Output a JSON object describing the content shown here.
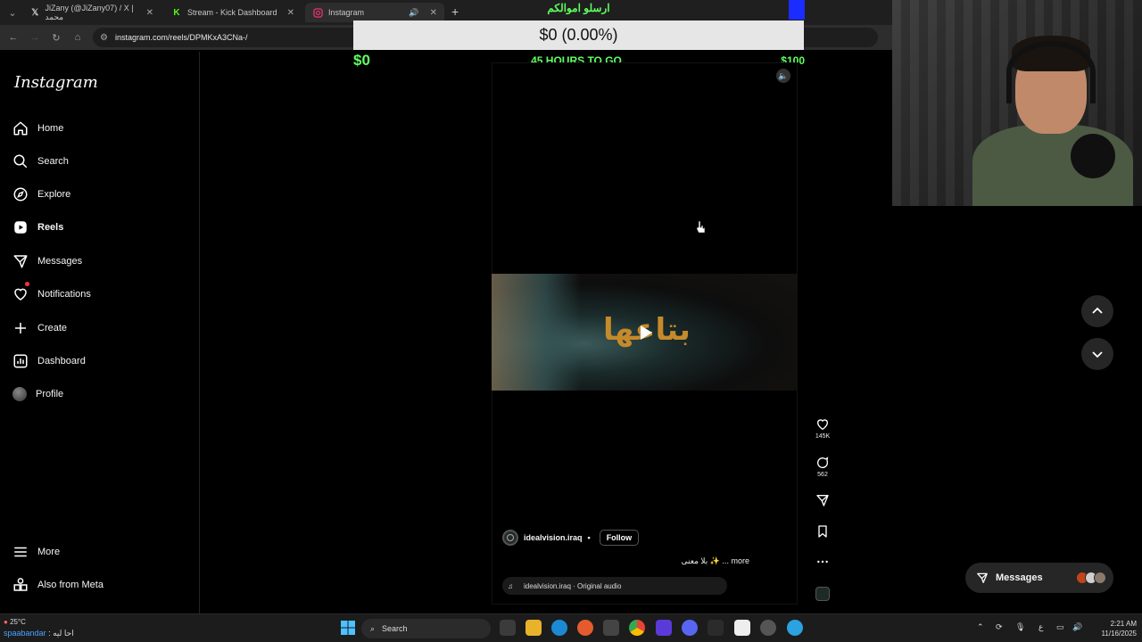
{
  "browser": {
    "tabs": [
      {
        "label": "JiZany (@JiZany07) / X | محمد",
        "icon": "x-icon"
      },
      {
        "label": "Stream - Kick Dashboard",
        "icon": "kick-icon"
      },
      {
        "label": "Instagram",
        "icon": "instagram-icon"
      }
    ],
    "new_tab": "+",
    "url": "instagram.com/reels/DPMKxA3CNa-/"
  },
  "stream_goal": {
    "title": "ارسلو اموالكم",
    "progress_text": "$0 (0.00%)",
    "progress_fraction": 0,
    "current": "$0",
    "time_left": "45 HOURS TO GO",
    "target": "$100",
    "accent": "#5fff5f"
  },
  "sidebar": {
    "logo": "Instagram",
    "items": [
      {
        "label": "Home",
        "icon": "home-icon"
      },
      {
        "label": "Search",
        "icon": "search-icon"
      },
      {
        "label": "Explore",
        "icon": "explore-icon"
      },
      {
        "label": "Reels",
        "icon": "reels-icon"
      },
      {
        "label": "Messages",
        "icon": "messages-icon"
      },
      {
        "label": "Notifications",
        "icon": "heart-icon"
      },
      {
        "label": "Create",
        "icon": "plus-icon"
      },
      {
        "label": "Dashboard",
        "icon": "dashboard-icon"
      },
      {
        "label": "Profile",
        "icon": "avatar"
      }
    ],
    "bottom": [
      {
        "label": "More",
        "icon": "menu-icon"
      },
      {
        "label": "Also from Meta",
        "icon": "meta-icon"
      }
    ]
  },
  "reel": {
    "video_text": "بتاعها",
    "author": "idealvision.iraq",
    "separator": "•",
    "follow": "Follow",
    "caption": "بلا معنى ✨ ... more",
    "audio": "idealvision.iraq · Original audio",
    "likes": "145K",
    "comments": "562"
  },
  "messages_pill": {
    "label": "Messages"
  },
  "taskbar": {
    "temperature": "25°C",
    "ticker_user": "spaabandar",
    "ticker_msg": ": احا ليه",
    "search_placeholder": "Search",
    "lang": "ع",
    "time": "2:21 AM",
    "date": "11/16/2025"
  }
}
